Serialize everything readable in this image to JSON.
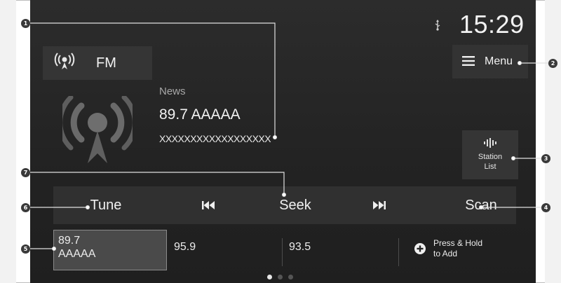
{
  "status": {
    "clock": "15:29",
    "usb_icon": "usb-icon"
  },
  "source": {
    "label": "FM",
    "icon": "radio-antenna-icon"
  },
  "menu": {
    "label": "Menu",
    "icon": "hamburger-menu-icon"
  },
  "now_playing": {
    "genre": "News",
    "station": "89.7 AAAAA",
    "rds_text": "XXXXXXXXXXXXXXXXXX"
  },
  "station_list": {
    "line1": "Station",
    "line2": "List",
    "icon": "station-list-icon"
  },
  "controls": {
    "tune": "Tune",
    "seek": "Seek",
    "scan": "Scan",
    "prev_icon": "skip-back-icon",
    "next_icon": "skip-forward-icon"
  },
  "presets": {
    "p1_line1": "89.7",
    "p1_line2": "AAAAA",
    "p2": "95.9",
    "p3": "93.5",
    "add_line1": "Press & Hold",
    "add_line2": "to Add",
    "add_icon": "plus-circle-icon"
  },
  "page_indicator": {
    "count": 3,
    "active": 1
  },
  "callouts": {
    "c1": "1",
    "c2": "2",
    "c3": "3",
    "c4": "4",
    "c5": "5",
    "c6": "6",
    "c7": "7"
  },
  "colors": {
    "screen_bg": "#262626",
    "button_bg": "#353535",
    "text": "#f0f0f0",
    "subtext": "#a8a8a8"
  }
}
